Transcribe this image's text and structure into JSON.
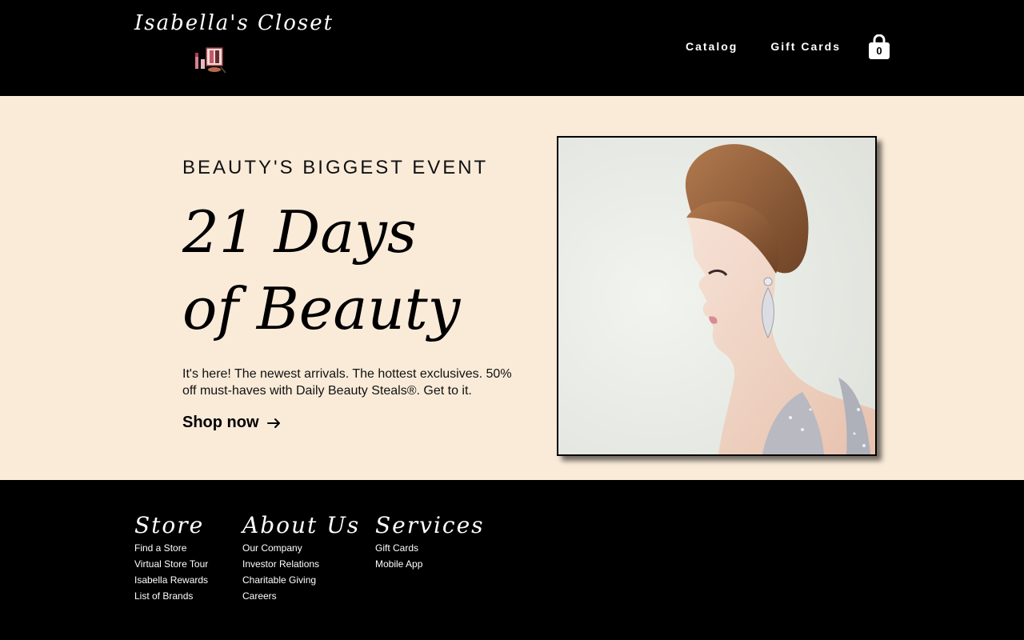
{
  "header": {
    "brand": "Isabella's Closet",
    "nav": [
      "Catalog",
      "Gift Cards"
    ],
    "cart_count": "0"
  },
  "hero": {
    "eyebrow": "BEAUTY'S BIGGEST EVENT",
    "headline": "21 Days of Beauty",
    "description": "It's here! The newest arrivals. The hottest exclusives. 50% off must-haves with Daily Beauty Steals®. Get to it.",
    "cta": "Shop now",
    "cta_icon": "arrow-right-icon"
  },
  "footer": {
    "columns": [
      {
        "title": "Store",
        "links": [
          "Find a Store",
          "Virtual Store Tour",
          "Isabella Rewards",
          "List of Brands"
        ]
      },
      {
        "title": "About Us",
        "links": [
          "Our Company",
          "Investor Relations",
          "Charitable Giving",
          "Careers"
        ]
      },
      {
        "title": "Services",
        "links": [
          "Gift Cards",
          "Mobile App"
        ]
      }
    ]
  },
  "colors": {
    "header_bg": "#000000",
    "hero_bg": "#faebd9",
    "footer_bg": "#000000",
    "text_light": "#ffffff"
  }
}
